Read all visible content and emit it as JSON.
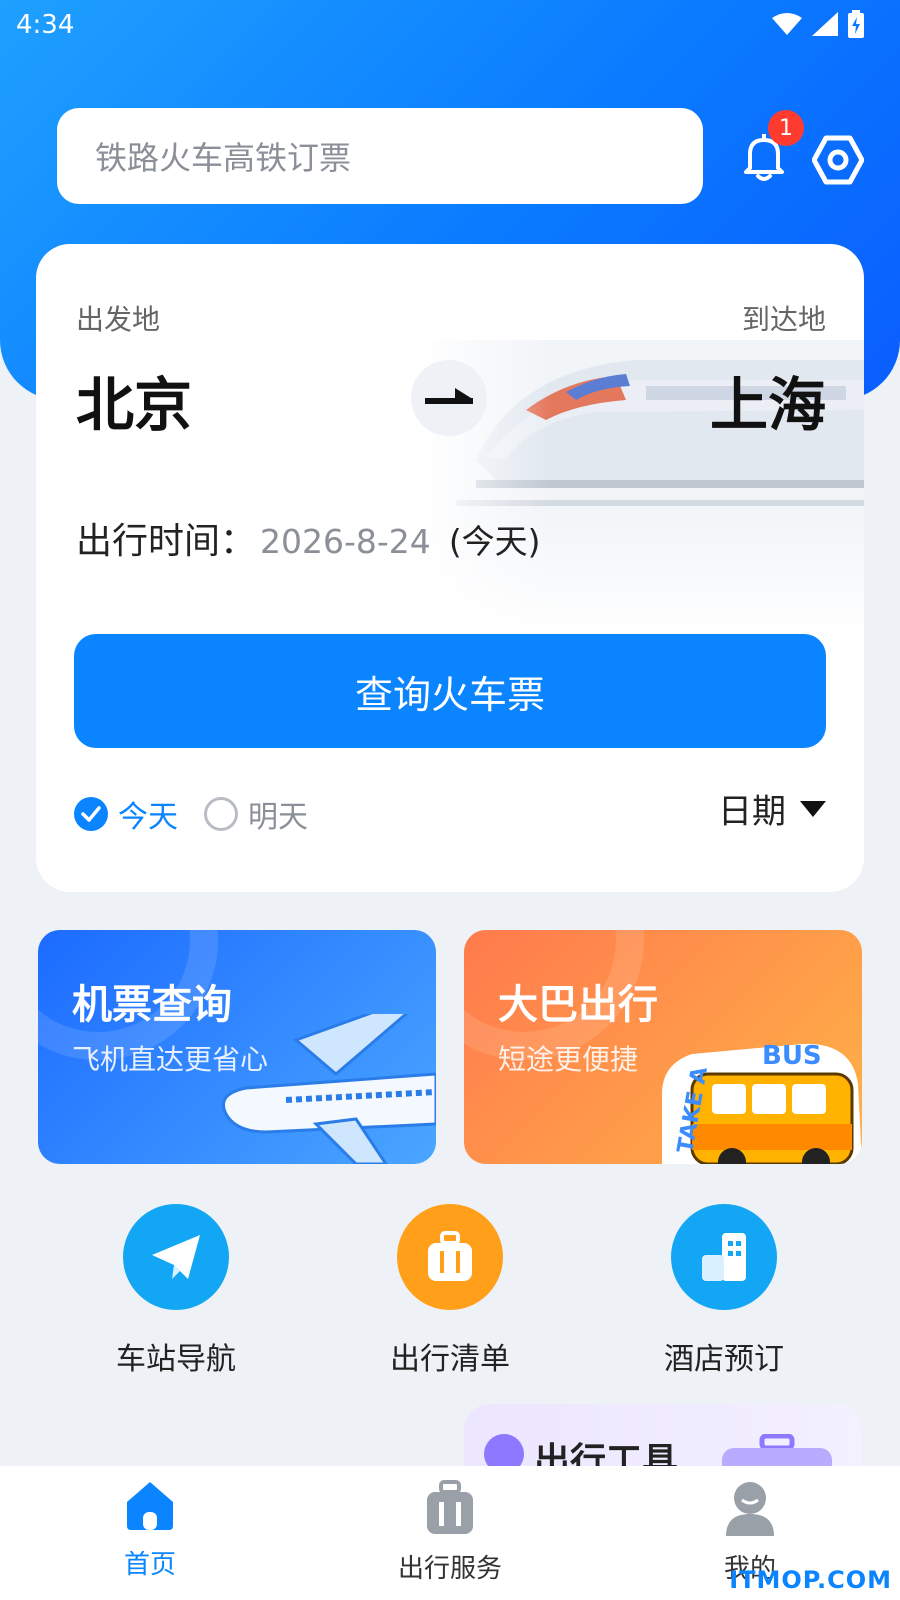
{
  "status_bar": {
    "time": "4:34"
  },
  "search": {
    "placeholder": "铁路火车高铁订票"
  },
  "notifications": {
    "count": "1"
  },
  "booking": {
    "from_label": "出发地",
    "to_label": "到达地",
    "from_city": "北京",
    "to_city": "上海",
    "date_label": "出行时间：",
    "date_value": "2026-8-24",
    "date_tag": "(今天)",
    "query_button": "查询火车票",
    "option_today": "今天",
    "option_tomorrow": "明天",
    "date_picker": "日期"
  },
  "promos": {
    "flight": {
      "title": "机票查询",
      "subtitle": "飞机直达更省心"
    },
    "bus": {
      "title": "大巴出行",
      "subtitle": "短途更便捷",
      "sticker_text": "TAKE A BUS"
    }
  },
  "shortcuts": [
    {
      "label": "车站导航",
      "icon": "paper-plane-icon",
      "color": "#12a6f5"
    },
    {
      "label": "出行清单",
      "icon": "luggage-icon",
      "color": "#ff9f1a"
    },
    {
      "label": "酒店预订",
      "icon": "building-icon",
      "color": "#12a6f5"
    }
  ],
  "tools_card": {
    "title": "出行工具"
  },
  "tabbar": {
    "items": [
      {
        "label": "首页",
        "icon": "home-icon"
      },
      {
        "label": "出行服务",
        "icon": "briefcase-icon"
      },
      {
        "label": "我的",
        "icon": "user-icon"
      }
    ]
  },
  "watermark": "ITMOP.COM",
  "colors": {
    "primary": "#0a84ff",
    "badge": "#ff3b30",
    "bus_orange": "#ff8a4a"
  }
}
